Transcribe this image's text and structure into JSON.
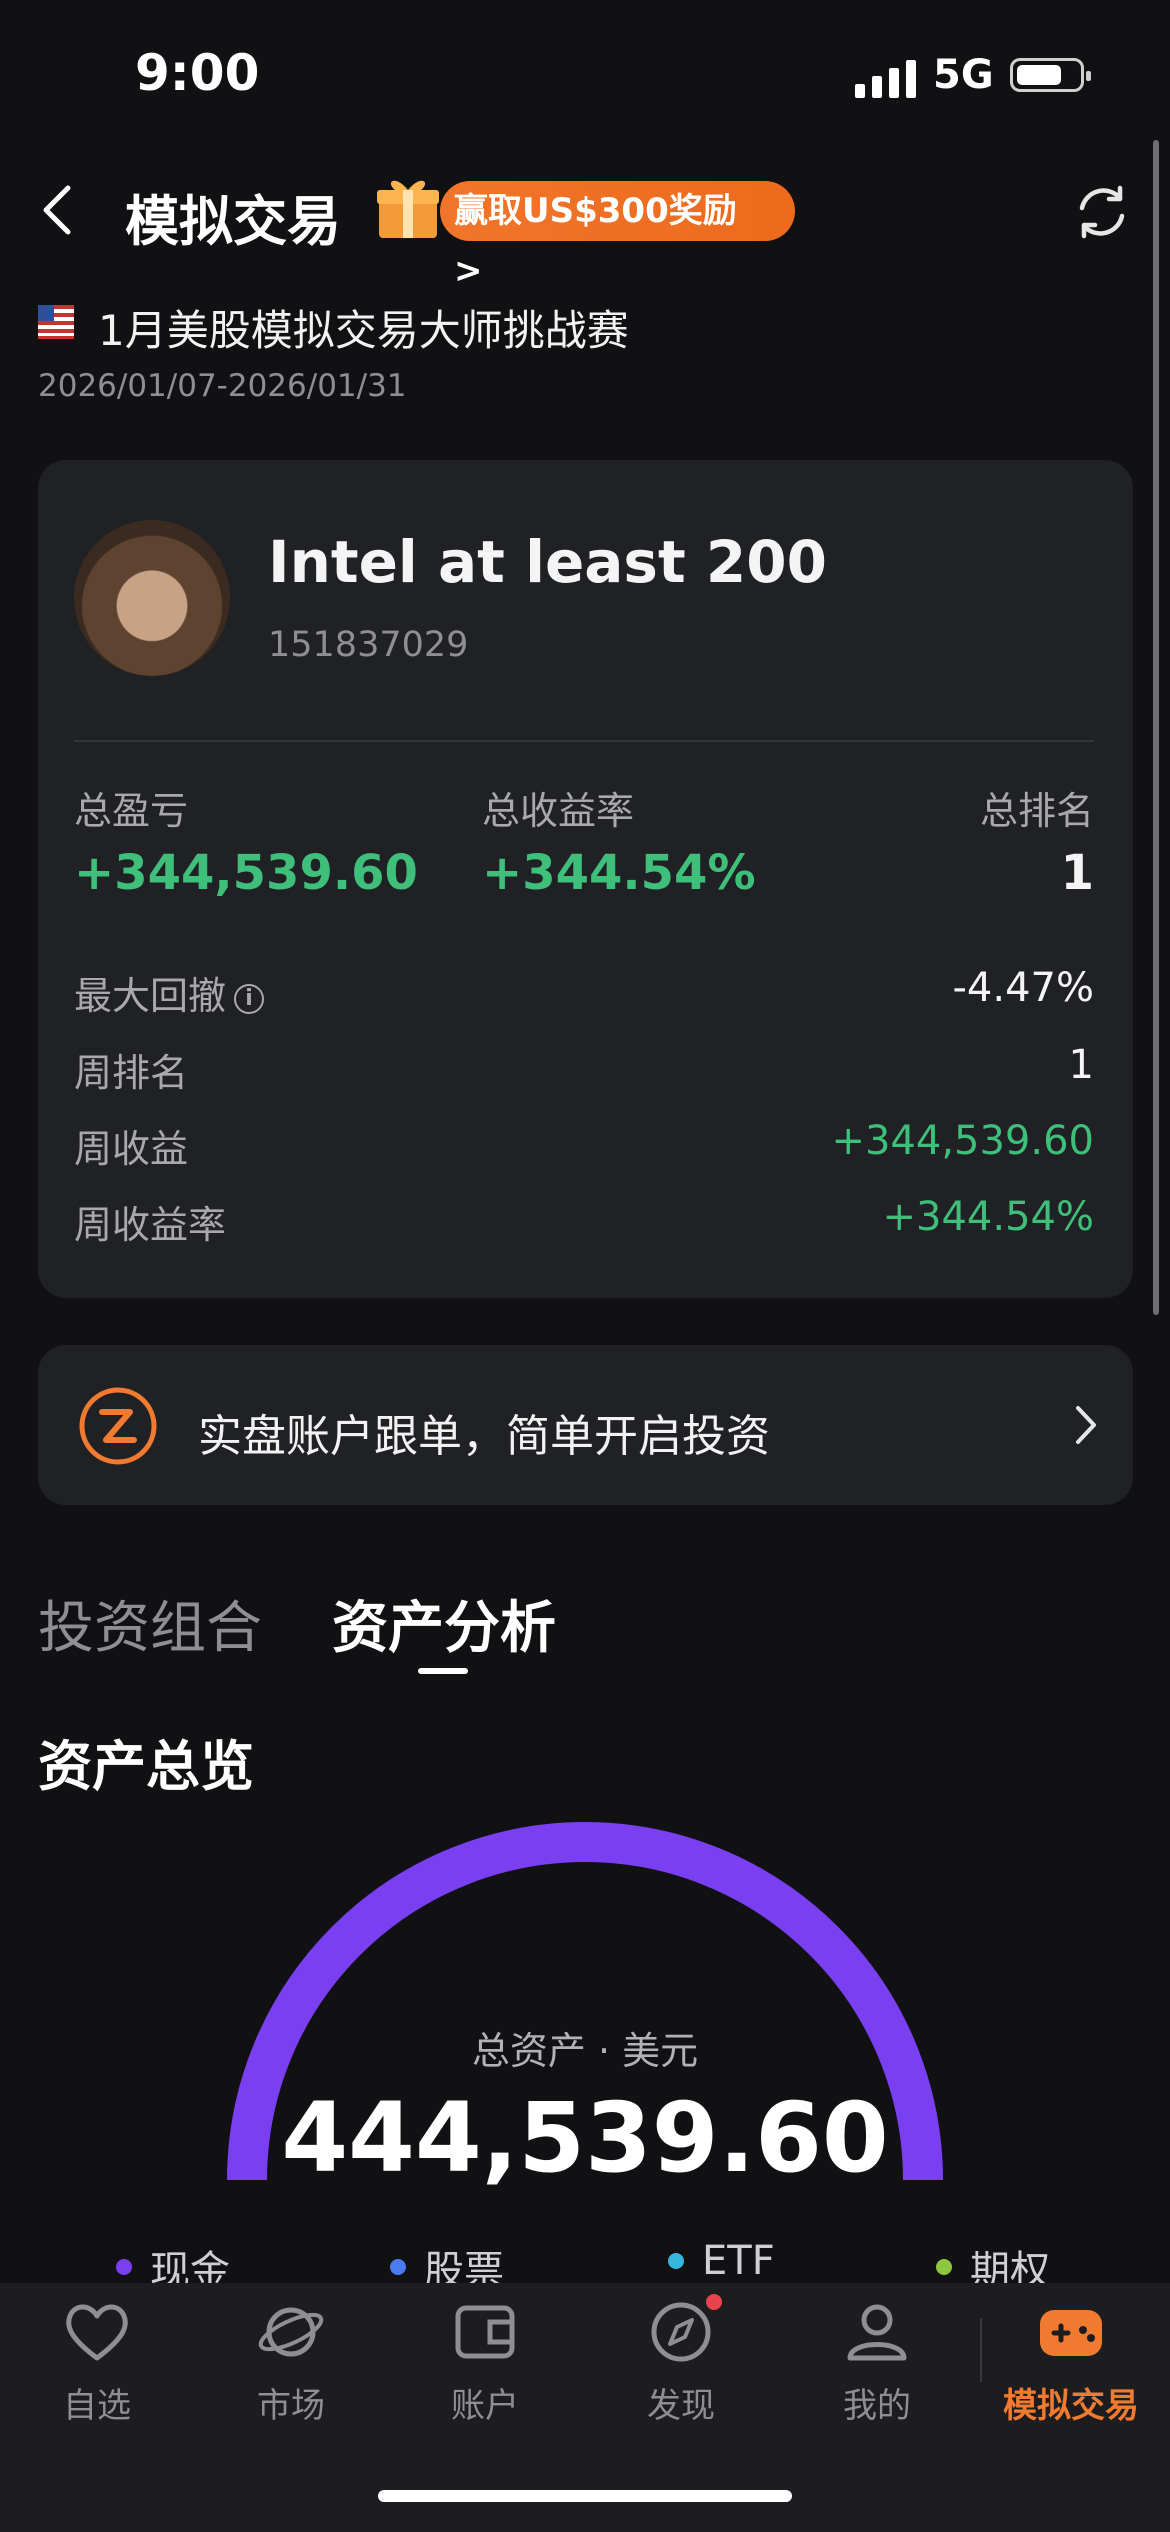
{
  "status_bar": {
    "time": "9:00",
    "network": "5G"
  },
  "header": {
    "title": "模拟交易",
    "promo_label": "赢取US$300奖励 >",
    "back_icon": "chevron-left-icon",
    "refresh_icon": "refresh-icon"
  },
  "contest": {
    "flag_icon": "us-flag-icon",
    "name": "1月美股模拟交易大师挑战赛",
    "dates": "2026/01/07-2026/01/31"
  },
  "profile": {
    "username": "Intel at least 200",
    "user_id": "151837029",
    "stats": [
      {
        "label": "总盈亏",
        "value": "+344,539.60"
      },
      {
        "label": "总收益率",
        "value": "+344.54%"
      },
      {
        "label": "总排名",
        "value": "1"
      }
    ],
    "details": [
      {
        "label": "最大回撤",
        "value": "-4.47%"
      },
      {
        "label": "周排名",
        "value": "1"
      },
      {
        "label": "周收益",
        "value": "+344,539.60"
      },
      {
        "label": "周收益率",
        "value": "+344.54%"
      }
    ],
    "info_glyph": "i"
  },
  "follow_banner": {
    "text": "实盘账户跟单，简单开启投资"
  },
  "tabs": [
    {
      "label": "投资组合",
      "active": false
    },
    {
      "label": "资产分析",
      "active": true
    }
  ],
  "overview": {
    "title": "资产总览",
    "total_label": "总资产 · 美元",
    "total_value": "444,539.60",
    "legend": [
      {
        "label": "现金",
        "color": "#7b3ff2"
      },
      {
        "label": "股票",
        "color": "#4a7cf0"
      },
      {
        "label": "ETF",
        "color": "#35b7e0"
      },
      {
        "label": "期权",
        "color": "#8dc63f"
      }
    ]
  },
  "bottom_nav": [
    {
      "label": "自选",
      "icon": "heart-icon"
    },
    {
      "label": "市场",
      "icon": "planet-icon"
    },
    {
      "label": "账户",
      "icon": "wallet-icon"
    },
    {
      "label": "发现",
      "icon": "compass-icon"
    },
    {
      "label": "我的",
      "icon": "person-icon"
    },
    {
      "label": "模拟交易",
      "icon": "gamepad-icon",
      "active": true
    }
  ],
  "colors": {
    "accent": "#f07a2f",
    "positive": "#3ebf7a",
    "gauge": "#7b3ff2"
  }
}
